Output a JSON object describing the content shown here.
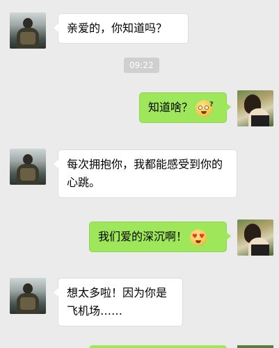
{
  "messages": [
    {
      "side": "left",
      "text": "亲爱的，你知道吗？"
    },
    {
      "side": "right",
      "text": "知道啥？",
      "emoji": "confused-face-icon"
    },
    {
      "side": "left",
      "text": "每次拥抱你，我都能感受到你的心跳。"
    },
    {
      "side": "right",
      "text": "我们爱的深沉啊！",
      "emoji": "heart-eyes-face-icon"
    },
    {
      "side": "left",
      "text": "想太多啦！因为你是飞机场……"
    }
  ],
  "timestamp": "09:22",
  "colors": {
    "background": "#ebebeb",
    "incoming_bubble": "#ffffff",
    "outgoing_bubble": "#9fe75a",
    "timestamp_bg": "#cfcfcf"
  }
}
